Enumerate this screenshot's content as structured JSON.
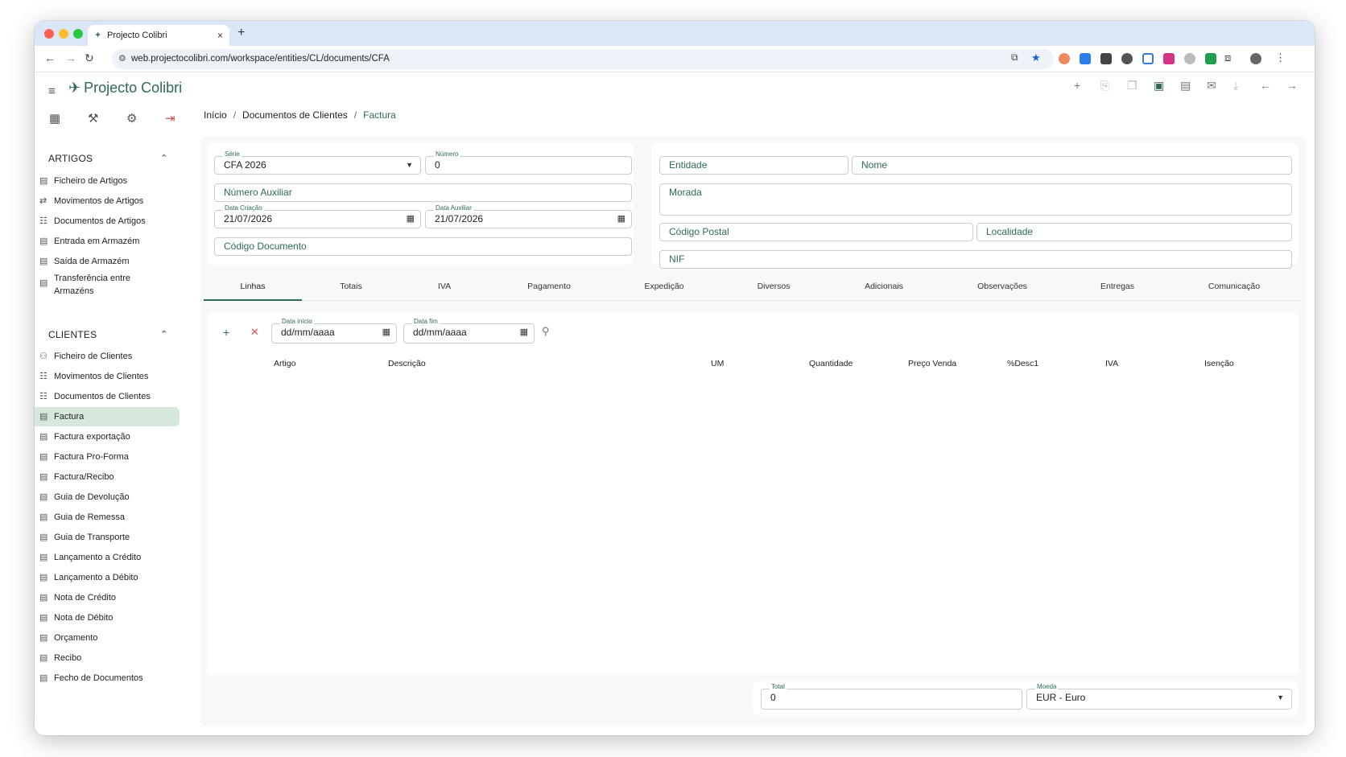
{
  "browser": {
    "tab_title": "Projecto Colibri",
    "tab_close": "×",
    "new_tab": "+",
    "url": "web.projectocolibri.com/workspace/entities/CL/documents/CFA"
  },
  "app": {
    "name": "Projecto Colibri",
    "breadcrumb": [
      "Início",
      "Documentos de Clientes",
      "Factura"
    ],
    "breadcrumb_sep": "/"
  },
  "sidebar": {
    "artigos_title": "ARTIGOS",
    "artigos": [
      "Ficheiro de Artigos",
      "Movimentos de Artigos",
      "Documentos de Artigos",
      "Entrada em Armazém",
      "Saída de Armazém",
      "Transferência entre Armazéns"
    ],
    "clientes_title": "CLIENTES",
    "clientes": [
      "Ficheiro de Clientes",
      "Movimentos de Clientes",
      "Documentos de Clientes",
      "Factura",
      "Factura exportação",
      "Factura Pro-Forma",
      "Factura/Recibo",
      "Guia de Devolução",
      "Guia de Remessa",
      "Guia de Transporte",
      "Lançamento a Crédito",
      "Lançamento a Débito",
      "Nota de Crédito",
      "Nota de Débito",
      "Orçamento",
      "Recibo",
      "Fecho de Documentos"
    ]
  },
  "form": {
    "serie_label": "Série",
    "serie_value": "CFA 2026",
    "numero_label": "Número",
    "numero_value": "0",
    "numero_auxiliar_placeholder": "Número Auxiliar",
    "data_criacao_label": "Data Criação",
    "data_criacao_value": "21/07/2026",
    "data_auxiliar_label": "Data Auxiliar",
    "data_auxiliar_value": "21/07/2026",
    "codigo_documento_placeholder": "Código Documento",
    "entidade_placeholder": "Entidade",
    "nome_placeholder": "Nome",
    "morada_placeholder": "Morada",
    "codigo_postal_placeholder": "Código Postal",
    "localidade_placeholder": "Localidade",
    "nif_placeholder": "NIF"
  },
  "tabs": [
    "Linhas",
    "Totais",
    "IVA",
    "Pagamento",
    "Expedição",
    "Diversos",
    "Adicionais",
    "Observações",
    "Entregas",
    "Comunicação"
  ],
  "lines": {
    "data_inicio_label": "Data início",
    "data_inicio_placeholder": "dd/mm/aaaa",
    "data_fim_label": "Data fim",
    "data_fim_placeholder": "dd/mm/aaaa",
    "columns": [
      "Artigo",
      "Descrição",
      "UM",
      "Quantidade",
      "Preço Venda",
      "%Desc1",
      "IVA",
      "Isenção"
    ]
  },
  "footer": {
    "total_label": "Total",
    "total_value": "0",
    "moeda_label": "Moeda",
    "moeda_value": "EUR - Euro"
  },
  "icons": {
    "back": "←",
    "forward": "→",
    "reload": "↻",
    "tune": "⚙",
    "hamburger": "≡",
    "plus": "+",
    "delete": "✕",
    "search": "⚲",
    "calendar": "▦",
    "dropdown": "▼",
    "chevron_up": "⌃",
    "doc": "▤",
    "move": "⇄",
    "grid": "☷",
    "tools": "⚒",
    "settings": "⚙",
    "logout": "⇥"
  },
  "colors": {
    "accent": "#2e6b4f",
    "active_item": "#d6e7dc",
    "tabstrip": "#dbe6f8"
  }
}
